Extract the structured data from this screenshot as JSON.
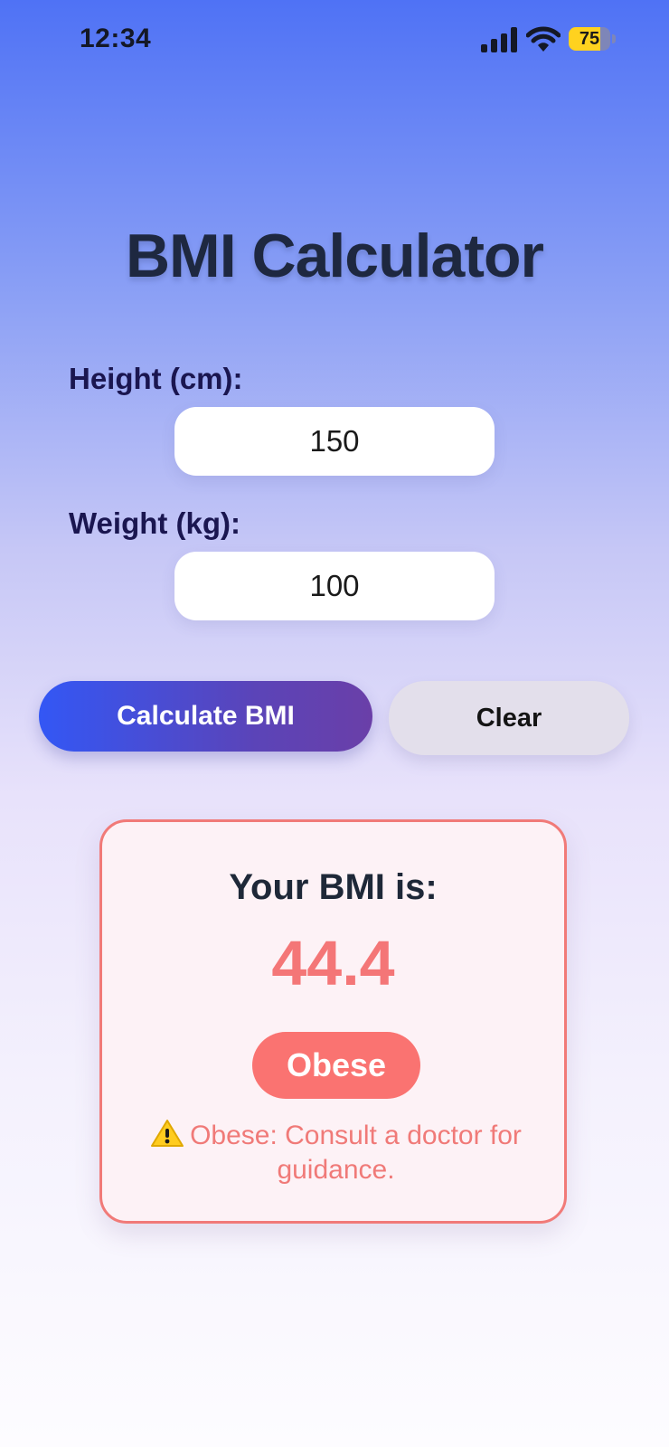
{
  "status_bar": {
    "time": "12:34",
    "battery_level": "75",
    "battery_fraction": 0.75,
    "icons": [
      "signal-icon",
      "wifi-icon",
      "battery-icon"
    ]
  },
  "title": "BMI Calculator",
  "form": {
    "height_label": "Height (cm):",
    "height_value": "150",
    "weight_label": "Weight (kg):",
    "weight_value": "100"
  },
  "buttons": {
    "calculate_label": "Calculate BMI",
    "clear_label": "Clear"
  },
  "result": {
    "heading": "Your BMI is:",
    "value": "44.4",
    "category": "Obese",
    "warning_icon": "warning-icon",
    "advice": "Obese: Consult a doctor for guidance."
  },
  "colors": {
    "accent_start": "#3357f5",
    "accent_end": "#6a3fa8",
    "danger": "#fa7371",
    "battery": "#ffd21f"
  }
}
